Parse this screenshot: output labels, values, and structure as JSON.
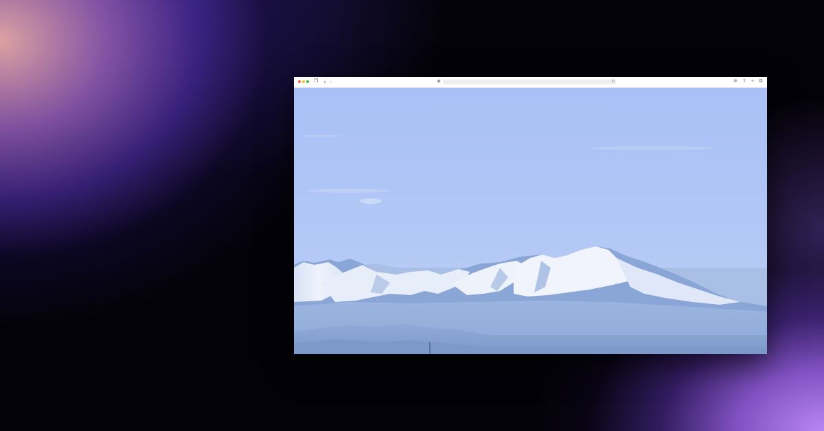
{
  "colors": {
    "background": "#030208",
    "glow_top_left": "#e8aaaa",
    "glow_mid_purple": "#4628a0",
    "glow_bottom_right": "#b987f5",
    "browser_chrome": "#ffffff",
    "traffic_red": "#ff5f57",
    "traffic_yellow": "#febc2e",
    "traffic_green": "#28c840",
    "sky_top": "#a9c0f6",
    "sky_horizon": "#c0d3f3",
    "snow": "#eef2fb",
    "mountain_shadow": "#7f9fd0",
    "haze_far": "#94b0dc",
    "haze_near": "#86a2d0"
  },
  "browser": {
    "toolbar": {
      "icons": [
        "close-dot",
        "minimize-dot",
        "zoom-dot",
        "sidebar-icon",
        "back-icon",
        "forward-icon",
        "shield-icon",
        "reload-icon",
        "download-icon",
        "share-icon",
        "plus-icon",
        "tabs-icon"
      ],
      "glyphs": {
        "sidebar": "❒",
        "back": "‹",
        "forward": "›",
        "shield": "◈",
        "reload": "↻",
        "download": "⊚",
        "share": "⇧",
        "plus": "+",
        "tabs": "⧉"
      },
      "url": ""
    },
    "content": {
      "type": "photo",
      "subject": "snow-capped-mountain-range"
    }
  }
}
